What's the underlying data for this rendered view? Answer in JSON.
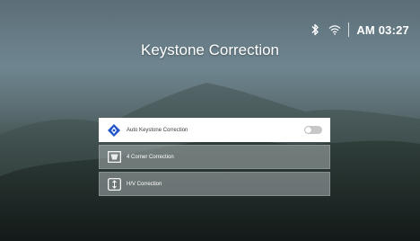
{
  "status": {
    "bluetooth_icon": "bluetooth-icon",
    "wifi_icon": "wifi-icon",
    "time": "AM 03:27"
  },
  "page": {
    "title": "Keystone Correction"
  },
  "menu": {
    "items": [
      {
        "label": "Auto Keystone Correction",
        "icon": "auto-keystone-icon",
        "toggle_on": false
      },
      {
        "label": "4 Corner Correction",
        "icon": "four-corner-icon"
      },
      {
        "label": "H/V Correction",
        "icon": "hv-correction-icon"
      }
    ]
  },
  "colors": {
    "selected_bg": "#ffffff",
    "item_bg": "#aab0b2",
    "accent": "#2355c9"
  }
}
